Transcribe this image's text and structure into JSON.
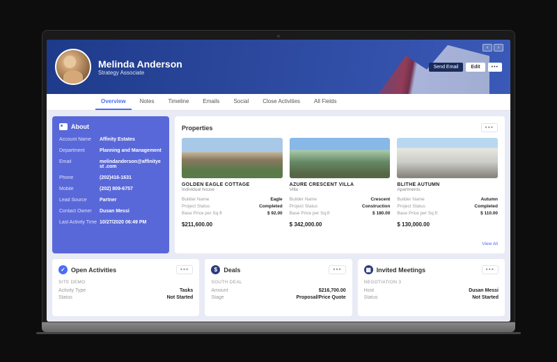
{
  "hero": {
    "name": "Melinda Anderson",
    "role": "Strategy Associate",
    "send_email": "Send Email",
    "edit": "Edit",
    "more": "•••"
  },
  "tabs": [
    "Overview",
    "Notes",
    "Timeline",
    "Emails",
    "Social",
    "Close Activities",
    "All Fields"
  ],
  "about": {
    "title": "About",
    "rows": [
      {
        "label": "Account Name",
        "value": "Affinity Estates"
      },
      {
        "label": "Department",
        "value": "Planning and Management"
      },
      {
        "label": "Email",
        "value": "melindanderson@affinityest .com"
      },
      {
        "label": "Phone",
        "value": "(202)416-1631"
      },
      {
        "label": "Mobile",
        "value": "(202) 809-6757"
      },
      {
        "label": "Lead Source",
        "value": "Partner"
      },
      {
        "label": "Contact Owner",
        "value": "Dusan Messi"
      },
      {
        "label": "Last Activity Time",
        "value": "10/27/2020   06:49 PM"
      }
    ]
  },
  "properties": {
    "title": "Properties",
    "view_all": "View All",
    "items": [
      {
        "name": "GOLDEN EAGLE COTTAGE",
        "type": "Individual house",
        "builder": "Eagle",
        "status": "Completed",
        "base": "$ 92.00",
        "price": "$211,600.00"
      },
      {
        "name": "AZURE CRESCENT VILLA",
        "type": "Villa",
        "builder": "Crescent",
        "status": "Construction",
        "base": "$ 180.00",
        "price": "$ 342,000.00"
      },
      {
        "name": "BLITHE AUTUMN",
        "type": "Apartments",
        "builder": "Autumn",
        "status": "Completed",
        "base": "$ 110.00",
        "price": "$ 130,000.00"
      }
    ],
    "labels": {
      "builder": "Builder Name",
      "status": "Project Status",
      "base": "Base Price per Sq.ft"
    }
  },
  "open_activities": {
    "title": "Open Activities",
    "sub": "SITE DEMO",
    "rows": [
      {
        "label": "Activity Type",
        "value": "Tasks"
      },
      {
        "label": "Status",
        "value": "Not Started"
      }
    ]
  },
  "deals": {
    "title": "Deals",
    "sub": "SOUTH DEAL",
    "rows": [
      {
        "label": "Amount",
        "value": "$216,700.00"
      },
      {
        "label": "Stage",
        "value": "Proposal/Price Quote"
      }
    ]
  },
  "meetings": {
    "title": "Invited Meetings",
    "sub": "NEGOTIATION 3",
    "rows": [
      {
        "label": "Host",
        "value": "Dusan Messi"
      },
      {
        "label": "Status",
        "value": "Not Started"
      }
    ]
  }
}
